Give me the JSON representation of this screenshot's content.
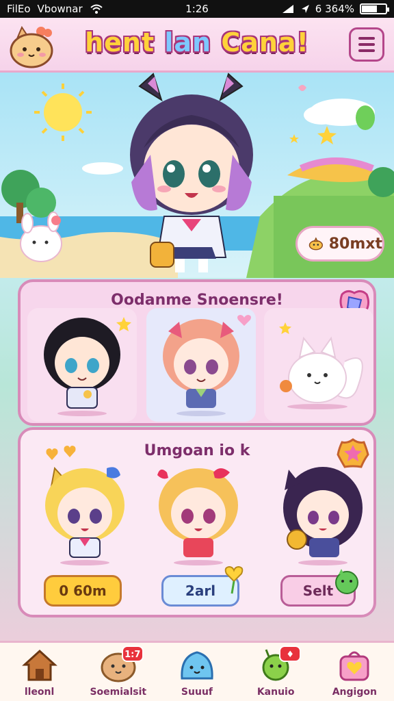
{
  "status_bar": {
    "carrier": "FilEo",
    "network": "Vbownar",
    "time": "1:26",
    "battery_text": "6 364%",
    "battery_level": 0.64
  },
  "header": {
    "title_part1": "hent",
    "title_part2": "lan",
    "title_part3": "Cana!"
  },
  "scene": {
    "coin_amount": "80mxt"
  },
  "panel1": {
    "title": "Oodanme Snoensre!"
  },
  "panel2": {
    "title": "Umgoan io k",
    "buttons": [
      {
        "label": "0 60m"
      },
      {
        "label": "2arl"
      },
      {
        "label": "Selt"
      }
    ]
  },
  "nav": {
    "items": [
      {
        "label": "lleonl",
        "icon": "house-icon",
        "badge": ""
      },
      {
        "label": "Soemialsit",
        "icon": "bean-face-icon",
        "badge": "1:7"
      },
      {
        "label": "Suuuf",
        "icon": "blue-slime-icon",
        "badge": ""
      },
      {
        "label": "Kanuio",
        "icon": "green-creature-icon",
        "badge": "♦"
      },
      {
        "label": "Angigon",
        "icon": "heart-bag-icon",
        "badge": ""
      }
    ]
  },
  "colors": {
    "accent_pink": "#d88bb9",
    "title_yellow": "#ffd23a",
    "badge_red": "#e8323c"
  }
}
